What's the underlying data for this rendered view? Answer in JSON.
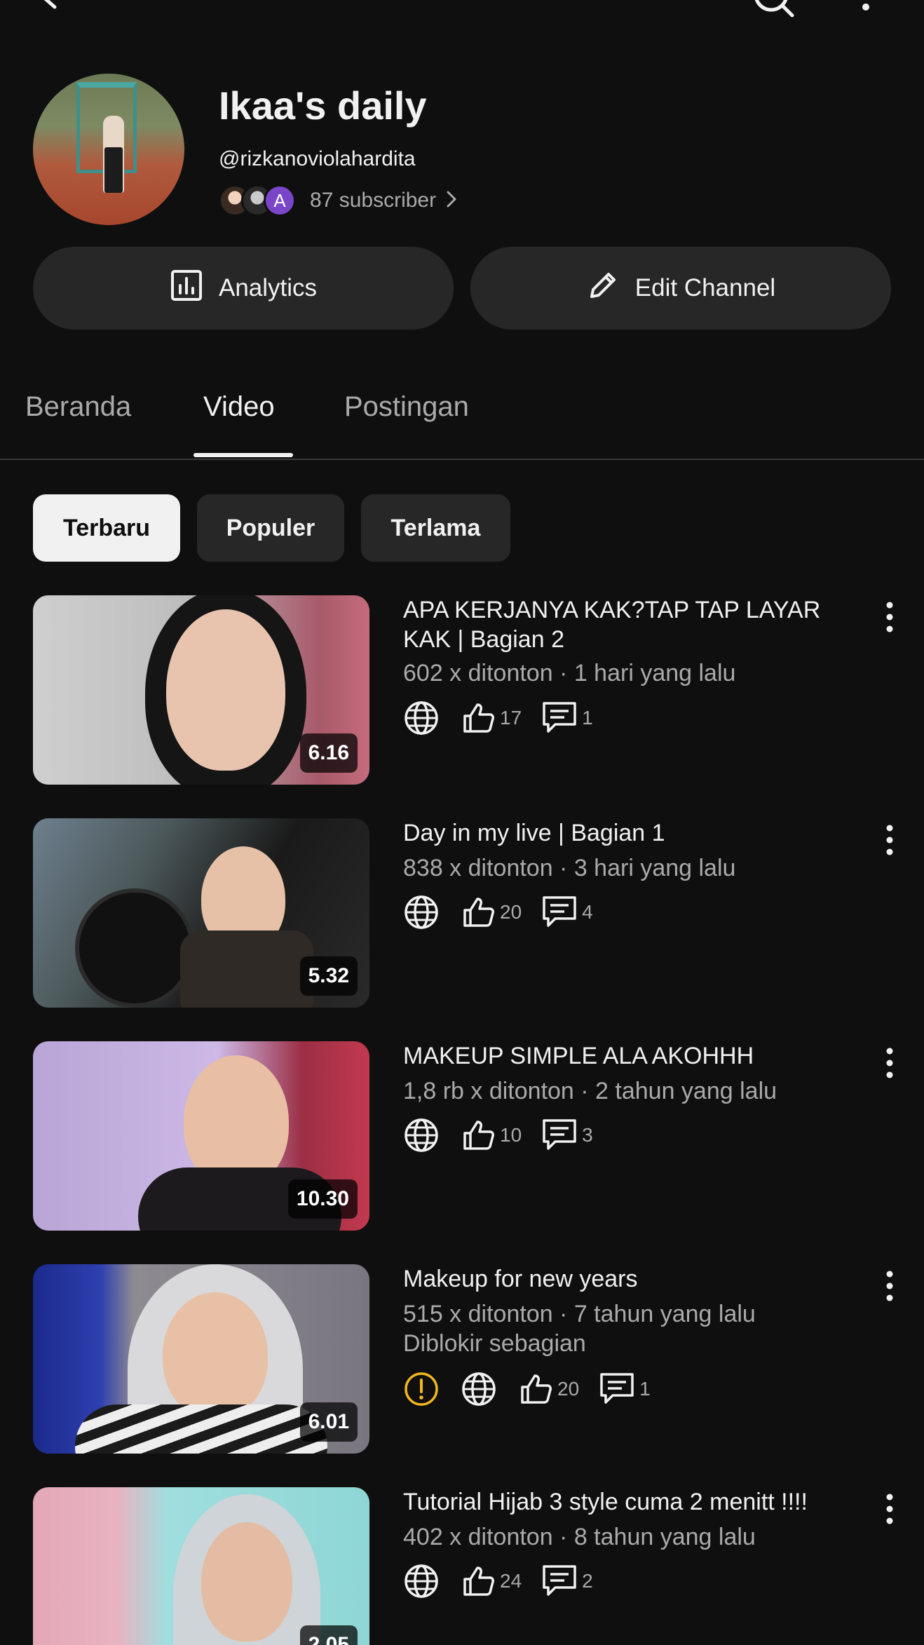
{
  "channel": {
    "title": "Ikaa's daily",
    "handle": "@rizkanoviolahardita",
    "subscriber_avatar_letter": "A",
    "subscribers": "87 subscriber"
  },
  "actions": {
    "analytics_label": "Analytics",
    "edit_label": "Edit Channel"
  },
  "tabs": [
    {
      "label": "Beranda",
      "active": false
    },
    {
      "label": "Video",
      "active": true
    },
    {
      "label": "Postingan",
      "active": false
    }
  ],
  "filters": [
    {
      "label": "Terbaru",
      "active": true
    },
    {
      "label": "Populer",
      "active": false
    },
    {
      "label": "Terlama",
      "active": false
    }
  ],
  "colors": {
    "background": "#0f0f0f",
    "surface": "#272727",
    "text_primary": "#f1f1f1",
    "text_secondary": "#aaaaaa",
    "warning": "#f2b61f",
    "subscriber_avatar": "#7b45c8"
  },
  "icons": {
    "back": "arrow-left-icon",
    "search": "search-icon",
    "more": "more-vertical-icon",
    "analytics": "bar-chart-icon",
    "edit": "pencil-icon",
    "visibility": "globe-icon",
    "likes": "thumbs-up-icon",
    "comments": "comment-icon",
    "warning": "warning-circle-icon"
  },
  "videos": [
    {
      "title": "APA KERJANYA KAK?TAP TAP LAYAR KAK | Bagian 2",
      "meta": "602 x ditonton · 1 hari yang lalu",
      "likes": "17",
      "comments": "1",
      "duration": "6.16",
      "status": ""
    },
    {
      "title": "Day in my live | Bagian 1",
      "meta": "838 x ditonton · 3 hari yang lalu",
      "likes": "20",
      "comments": "4",
      "duration": "5.32",
      "status": ""
    },
    {
      "title": "MAKEUP SIMPLE ALA AKOHHH",
      "meta": "1,8 rb x ditonton · 2 tahun yang lalu",
      "likes": "10",
      "comments": "3",
      "duration": "10.30",
      "status": ""
    },
    {
      "title": "Makeup for new years",
      "meta": "515 x ditonton · 7 tahun yang lalu",
      "status": "Diblokir sebagian",
      "likes": "20",
      "comments": "1",
      "duration": "6.01"
    },
    {
      "title": "Tutorial Hijab 3 style cuma 2 menitt !!!!",
      "meta": "402 x ditonton · 8 tahun yang lalu",
      "likes": "24",
      "comments": "2",
      "duration": "2.05",
      "status": ""
    }
  ]
}
